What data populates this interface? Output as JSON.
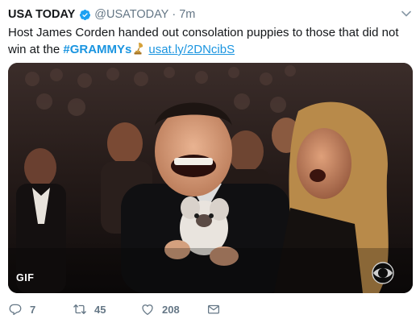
{
  "author": {
    "name": "USA TODAY",
    "handle": "@USATODAY",
    "separator": "·",
    "time": "7m"
  },
  "tweet": {
    "text_before": "Host James Corden handed out consolation puppies to those that did not win at the ",
    "hashtag": "#GRAMMYs",
    "link": "usat.ly/2DNcibS"
  },
  "media": {
    "badge": "GIF",
    "network_logo": "cbs-eye-icon"
  },
  "actions": {
    "replies": "7",
    "retweets": "45",
    "likes": "208"
  },
  "colors": {
    "link": "#1b95e0",
    "muted": "#657786",
    "verified": "#1da1f2",
    "text": "#14171a"
  },
  "icons": [
    "verified-badge-icon",
    "chevron-down-icon",
    "grammy-gramophone-icon",
    "reply-icon",
    "retweet-icon",
    "like-icon",
    "direct-message-icon"
  ]
}
